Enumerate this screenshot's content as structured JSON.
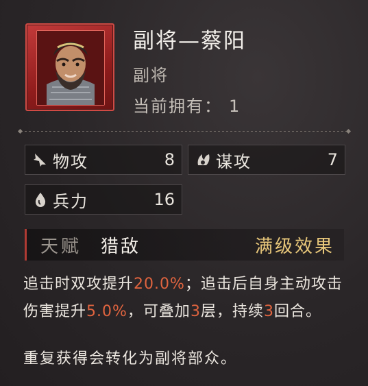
{
  "item": {
    "name": "副将—蔡阳",
    "type": "副将",
    "owned_label": "当前拥有：",
    "owned_count": "1"
  },
  "stats": {
    "physical_attack": {
      "label": "物攻",
      "value": "8",
      "icon": "claw-icon"
    },
    "strategy_attack": {
      "label": "谋攻",
      "value": "7",
      "icon": "flame-icon"
    },
    "troops": {
      "label": "兵力",
      "value": "16",
      "icon": "drop-icon"
    }
  },
  "talent": {
    "label": "天赋",
    "name": "猎敌",
    "effect_label": "满级效果"
  },
  "description": {
    "seg1": "追击时双攻提升",
    "v1": "20.0%",
    "seg2": "；追击后自身主动攻击伤害提升",
    "v2": "5.0%",
    "seg3": "，可叠加",
    "v3": "3",
    "seg4": "层，持续",
    "v4": "3",
    "seg5": "回合。",
    "highlight_color": "#e0643f"
  },
  "note": "重复获得会转化为副将部众。"
}
